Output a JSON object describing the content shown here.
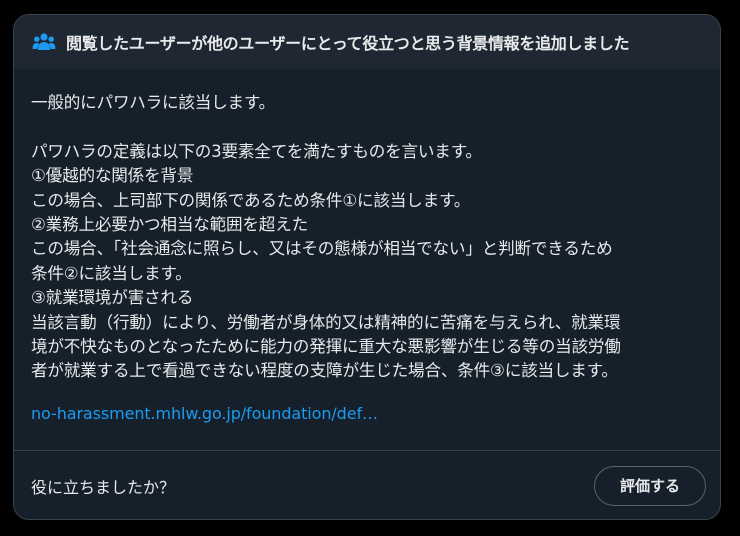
{
  "note": {
    "header_icon": "people-icon",
    "title": "閲覧したユーザーが他のユーザーにとって役立つと思う背景情報を追加しました",
    "body": "一般的にパワハラに該当します。\n\nパワハラの定義は以下の3要素全てを満たすものを言います。\n①優越的な関係を背景\nこの場合、上司部下の関係であるため条件①に該当します。\n②業務上必要かつ相当な範囲を超えた\nこの場合、「社会通念に照らし、又はその態様が相当でない」と判断できるため\n条件②に該当します。\n③就業環境が害される\n当該言動（行動）により、労働者が身体的又は精神的に苦痛を与えられ、就業環\n境が不快なものとなったために能力の発揮に重大な悪影響が生じる等の当該労働\n者が就業する上で看過できない程度の支障が生じた場合、条件③に該当します。",
    "source_link": "no-harassment.mhlw.go.jp/foundation/def…"
  },
  "footer": {
    "question": "役に立ちましたか？",
    "rate_button": "評価する"
  },
  "colors": {
    "card_background": "#15202b",
    "header_background": "#1e2732",
    "text": "#e7e9ea",
    "link": "#1d9bf0",
    "border": "#38444d",
    "icon": "#1d9bf0"
  }
}
